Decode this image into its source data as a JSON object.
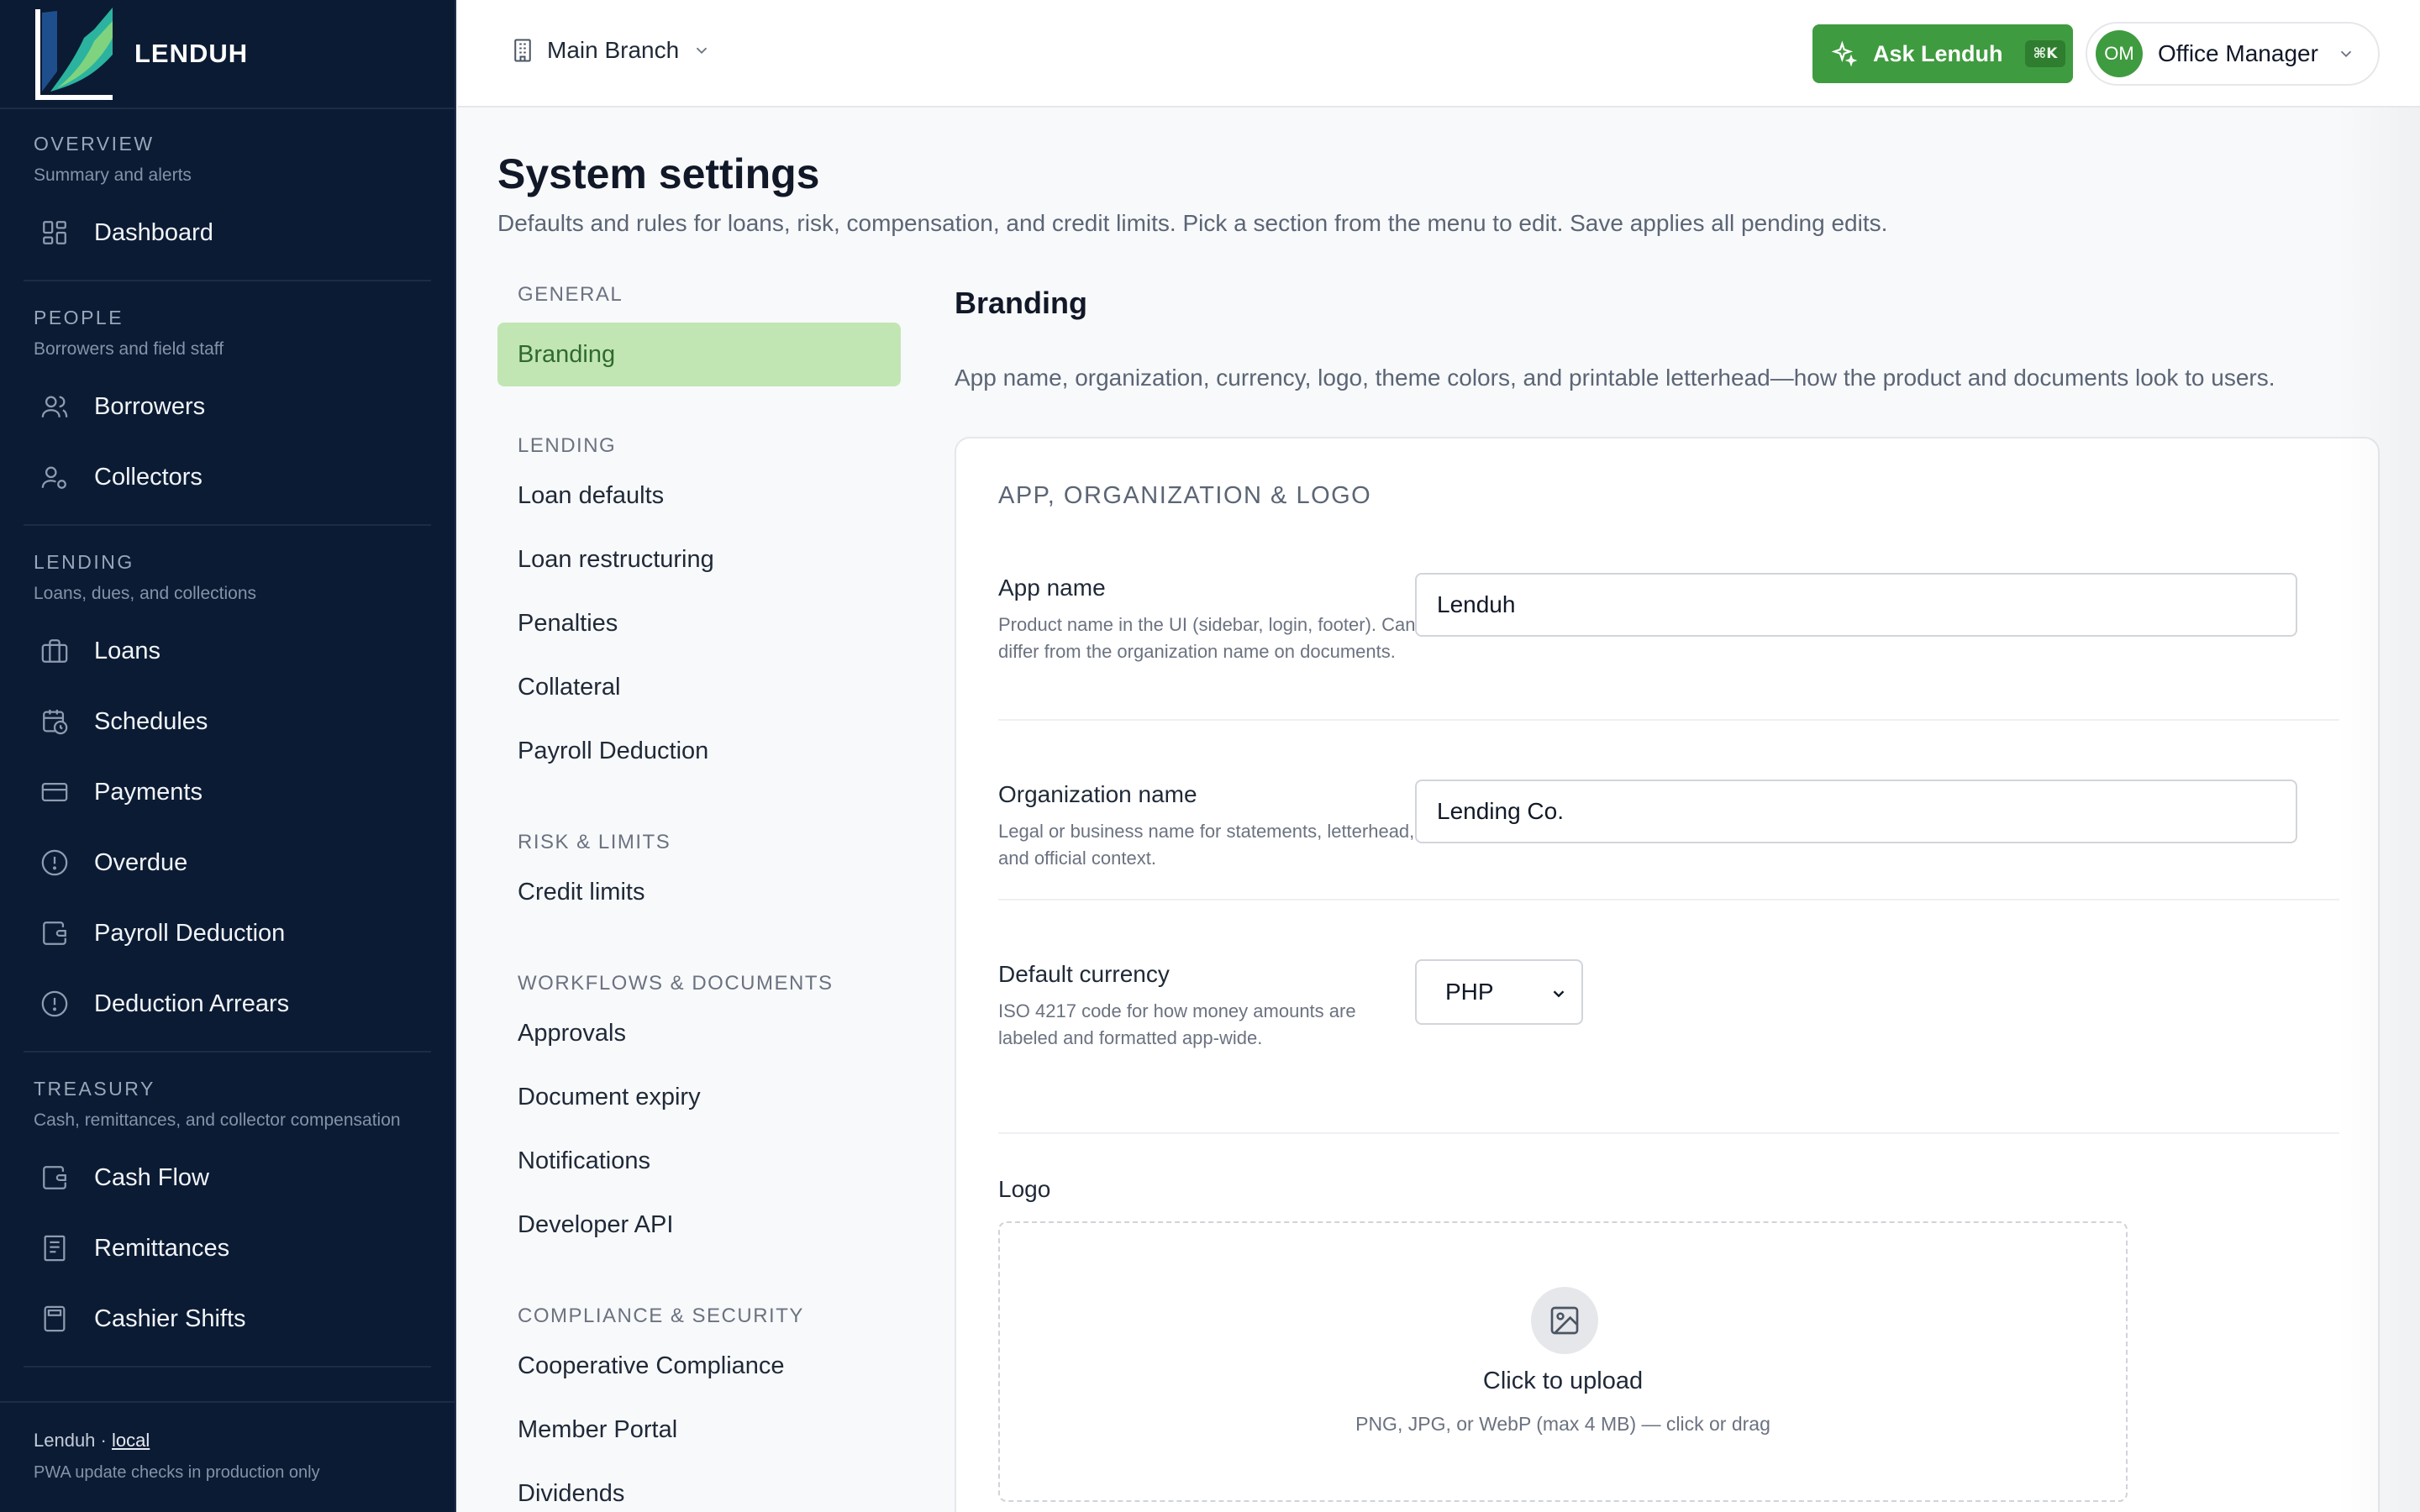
{
  "app": {
    "brand": "LENDUH"
  },
  "sidebar": {
    "groups": [
      {
        "title": "OVERVIEW",
        "subtitle": "Summary and alerts",
        "items": [
          {
            "label": "Dashboard",
            "icon": "dashboard-icon"
          }
        ]
      },
      {
        "title": "PEOPLE",
        "subtitle": "Borrowers and field staff",
        "items": [
          {
            "label": "Borrowers",
            "icon": "users-icon"
          },
          {
            "label": "Collectors",
            "icon": "user-gear-icon"
          }
        ]
      },
      {
        "title": "LENDING",
        "subtitle": "Loans, dues, and collections",
        "items": [
          {
            "label": "Loans",
            "icon": "briefcase-icon"
          },
          {
            "label": "Schedules",
            "icon": "calendar-clock-icon"
          },
          {
            "label": "Payments",
            "icon": "credit-card-icon"
          },
          {
            "label": "Overdue",
            "icon": "alert-circle-icon"
          },
          {
            "label": "Payroll Deduction",
            "icon": "wallet-icon"
          },
          {
            "label": "Deduction Arrears",
            "icon": "alert-circle-icon"
          }
        ]
      },
      {
        "title": "TREASURY",
        "subtitle": "Cash, remittances, and collector compensation",
        "items": [
          {
            "label": "Cash Flow",
            "icon": "wallet-icon"
          },
          {
            "label": "Remittances",
            "icon": "receipt-icon"
          },
          {
            "label": "Cashier Shifts",
            "icon": "calculator-icon"
          }
        ]
      }
    ],
    "footer": {
      "app": "Lenduh",
      "separator": "·",
      "env": "local",
      "note": "PWA update checks in production only"
    }
  },
  "topbar": {
    "branch": "Main Branch",
    "ask_label": "Ask Lenduh",
    "ask_shortcut": "⌘K",
    "user_initials": "OM",
    "user_role": "Office Manager"
  },
  "page": {
    "title": "System settings",
    "description": "Defaults and rules for loans, risk, compensation, and credit limits. Pick a section from the menu to edit. Save applies all pending edits."
  },
  "settings_menu": {
    "sections": [
      {
        "title": "GENERAL",
        "items": [
          "Branding"
        ]
      },
      {
        "title": "LENDING",
        "items": [
          "Loan defaults",
          "Loan restructuring",
          "Penalties",
          "Collateral",
          "Payroll Deduction"
        ]
      },
      {
        "title": "RISK & LIMITS",
        "items": [
          "Credit limits"
        ]
      },
      {
        "title": "WORKFLOWS & DOCUMENTS",
        "items": [
          "Approvals",
          "Document expiry",
          "Notifications",
          "Developer API"
        ]
      },
      {
        "title": "COMPLIANCE & SECURITY",
        "items": [
          "Cooperative Compliance",
          "Member Portal",
          "Dividends"
        ]
      }
    ],
    "active": "Branding"
  },
  "branding": {
    "title": "Branding",
    "description": "App name, organization, currency, logo, theme colors, and printable letterhead—how the product and documents look to users.",
    "card_title": "APP, ORGANIZATION & LOGO",
    "app_name": {
      "label": "App name",
      "help": "Product name in the UI (sidebar, login, footer). Can differ from the organization name on documents.",
      "value": "Lenduh"
    },
    "org_name": {
      "label": "Organization name",
      "help": "Legal or business name for statements, letterhead, and official context.",
      "value": "Lending Co."
    },
    "currency": {
      "label": "Default currency",
      "help": "ISO 4217 code for how money amounts are labeled and formatted app-wide.",
      "value": "PHP"
    },
    "logo": {
      "label": "Logo",
      "upload_title": "Click to upload",
      "upload_hint": "PNG, JPG, or WebP (max 4 MB) — click or drag"
    }
  },
  "colors": {
    "sidebar_bg": "#0b1b33",
    "accent_green": "#3f9b3f",
    "active_menu_bg": "#c2e6b3"
  }
}
